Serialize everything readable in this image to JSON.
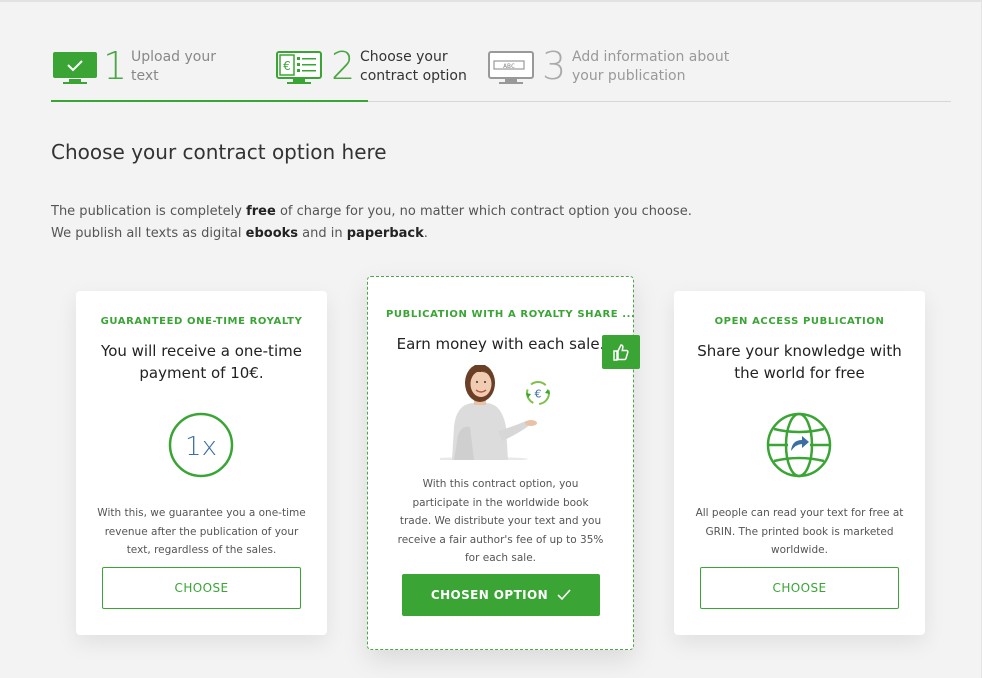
{
  "steps": [
    {
      "number": "1",
      "label_line1": "Upload your",
      "label_line2": "text",
      "icon": "monitor-check-icon",
      "state": "done"
    },
    {
      "number": "2",
      "label_line1": "Choose your",
      "label_line2": "contract option",
      "icon": "monitor-euro-list-icon",
      "state": "active"
    },
    {
      "number": "3",
      "label_line1": "Add information about",
      "label_line2": "your publication",
      "icon": "monitor-abc-icon",
      "state": "pending"
    }
  ],
  "page": {
    "title": "Choose your contract option here",
    "intro_line1_a": "The publication is completely ",
    "intro_line1_b": "free",
    "intro_line1_c": " of charge for you, no matter which contract option you choose.",
    "intro_line2_a": "We publish all texts as digital ",
    "intro_line2_b": "ebooks",
    "intro_line2_c": " and in ",
    "intro_line2_d": "paperback",
    "intro_line2_e": "."
  },
  "cards": [
    {
      "kicker": "GUARANTEED ONE-TIME ROYALTY",
      "headline_line1": "You will receive a one-time",
      "headline_line2": "payment of 10€.",
      "badge": "1x",
      "desc_line1": "With this, we guarantee you a one-time",
      "desc_line2": "revenue after the publication of your",
      "desc_line3": "text, regardless of the sales.",
      "button": "CHOOSE"
    },
    {
      "kicker": "PUBLICATION WITH A ROYALTY SHARE ...",
      "headline_line1": "Earn money with each sale.",
      "euro_symbol": "€",
      "desc_line1": "With this contract option, you",
      "desc_line2": "participate in the worldwide book",
      "desc_line3": "trade. We distribute your text and you",
      "desc_line4": "receive a fair author's fee of up to 35%",
      "desc_line5": "for each sale.",
      "button": "CHOSEN OPTION",
      "selected": true
    },
    {
      "kicker": "OPEN ACCESS PUBLICATION",
      "headline_line1": "Share your knowledge with",
      "headline_line2": "the world for free",
      "desc_line1": "All people can read your text for free at",
      "desc_line2": "GRIN. The printed book is marketed",
      "desc_line3": "worldwide.",
      "button": "CHOOSE"
    }
  ],
  "colors": {
    "accent": "#3aa535",
    "background": "#f3f3f3",
    "card": "#ffffff",
    "text": "#333333"
  }
}
